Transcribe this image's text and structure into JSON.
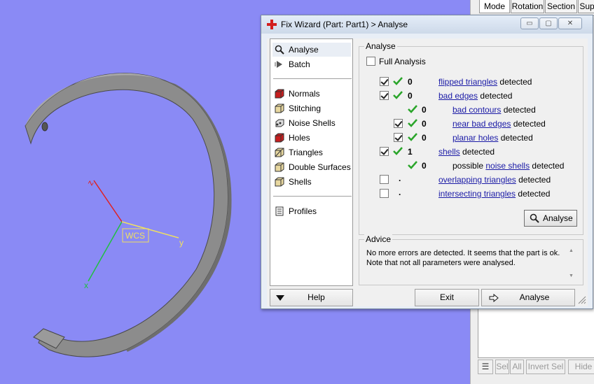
{
  "viewport": {
    "background_color": "#8a8af5",
    "axis_labels": {
      "x": "x",
      "y": "y",
      "z": "z",
      "wcs": "WCS"
    }
  },
  "side_panel": {
    "tabs": [
      "Mode",
      "Rotation",
      "Section",
      "Sup"
    ],
    "buttons": [
      "Sel",
      "All",
      "Invert Sel",
      "Hide Un"
    ]
  },
  "wizard": {
    "title": "Fix Wizard (Part: Part1) > Analyse",
    "window_controls": {
      "minimize": "▭",
      "maximize": "▢",
      "close": "✕"
    },
    "nav": {
      "items": [
        {
          "label": "Analyse",
          "icon": "magnifier-icon",
          "selected": true
        },
        {
          "label": "Batch",
          "icon": "batch-icon"
        },
        {
          "label": "Normals",
          "icon": "normals-cube-icon"
        },
        {
          "label": "Stitching",
          "icon": "stitching-cube-icon"
        },
        {
          "label": "Noise Shells",
          "icon": "noise-shells-icon"
        },
        {
          "label": "Holes",
          "icon": "holes-cube-icon"
        },
        {
          "label": "Triangles",
          "icon": "triangles-cube-icon"
        },
        {
          "label": "Double Surfaces",
          "icon": "double-surfaces-cube-icon"
        },
        {
          "label": "Shells",
          "icon": "shells-cube-icon"
        },
        {
          "label": "Profiles",
          "icon": "profiles-icon"
        }
      ]
    },
    "analyse": {
      "group_title": "Analyse",
      "full_analysis_label": "Full Analysis",
      "full_analysis_checked": false,
      "rows": [
        {
          "checked": true,
          "status": "tick",
          "count": "0",
          "link": "flipped triangles",
          "suffix": "detected",
          "indent": 0
        },
        {
          "checked": true,
          "status": "tick",
          "count": "0",
          "link": "bad edges",
          "suffix": "detected",
          "indent": 0
        },
        {
          "checked": null,
          "status": "tick",
          "count": "0",
          "link": "bad contours",
          "suffix": "detected",
          "indent": 1
        },
        {
          "checked": true,
          "status": "tick",
          "count": "0",
          "link": "near bad edges",
          "suffix": "detected",
          "indent": 1
        },
        {
          "checked": true,
          "status": "tick",
          "count": "0",
          "link": "planar holes",
          "suffix": "detected",
          "indent": 1
        },
        {
          "checked": true,
          "status": "tick",
          "count": "1",
          "link": "shells",
          "suffix": "detected",
          "indent": 0
        },
        {
          "checked": null,
          "status": "tick",
          "count": "0",
          "prefix": "possible",
          "link": "noise shells",
          "suffix": "detected",
          "indent": 1
        },
        {
          "checked": false,
          "status": "none",
          "count": ".",
          "link": "overlapping triangles",
          "suffix": "detected",
          "indent": 0
        },
        {
          "checked": false,
          "status": "none",
          "count": ".",
          "link": "intersecting triangles",
          "suffix": "detected",
          "indent": 0
        }
      ],
      "analyse_button": "Analyse"
    },
    "advice": {
      "group_title": "Advice",
      "text": "No more errors are detected. It seems that the part is ok. Note that not all parameters were analysed."
    },
    "bottom": {
      "help": "Help",
      "exit": "Exit",
      "analyse": "Analyse"
    },
    "colors": {
      "tick_green": "#2aa52a",
      "link_blue": "#1a1aa6",
      "title_icon_red": "#d21e1e"
    }
  }
}
